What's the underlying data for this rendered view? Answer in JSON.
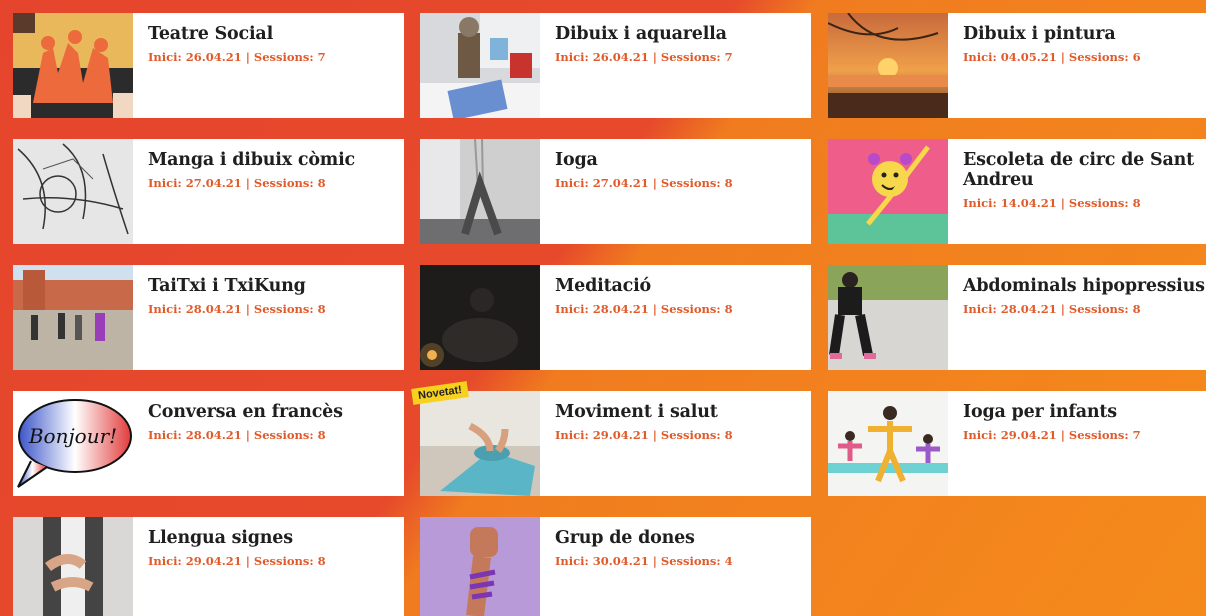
{
  "cards": [
    {
      "title": "Teatre Social",
      "meta": "Inici: 26.04.21 | Sessions: 7",
      "image": "theatre-illustration"
    },
    {
      "title": "Dibuix i aquarella",
      "meta": "Inici: 26.04.21 | Sessions: 7",
      "image": "painting-photo"
    },
    {
      "title": "Dibuix i pintura",
      "meta": "Inici: 04.05.21 | Sessions: 6",
      "image": "sunset-painting"
    },
    {
      "title": "Manga i dibuix còmic",
      "meta": "Inici: 27.04.21 | Sessions: 8",
      "image": "manga-sketch"
    },
    {
      "title": "Ioga",
      "meta": "Inici: 27.04.21 | Sessions: 8",
      "image": "aerial-yoga-photo"
    },
    {
      "title": "Escoleta de circ de Sant Andreu",
      "meta": "Inici: 14.04.21 | Sessions: 8",
      "image": "circus-drawing"
    },
    {
      "title": "TaiTxi i TxiKung",
      "meta": "Inici: 28.04.21 | Sessions: 8",
      "image": "taichi-photo"
    },
    {
      "title": "Meditació",
      "meta": "Inici: 28.04.21 | Sessions: 8",
      "image": "meditation-photo"
    },
    {
      "title": "Abdominals hipopressius",
      "meta": "Inici: 28.04.21 | Sessions: 8",
      "image": "squat-photo"
    },
    {
      "title": "Conversa en francès",
      "meta": "Inici: 28.04.21 | Sessions: 8",
      "image": "bonjour-bubble",
      "bubble_text": "Bonjour!"
    },
    {
      "title": "Moviment i salut",
      "meta": "Inici: 29.04.21 | Sessions: 8",
      "image": "yoga-mat-photo",
      "badge": "Novetat!"
    },
    {
      "title": "Ioga per infants",
      "meta": "Inici: 29.04.21 | Sessions: 7",
      "image": "kids-yoga-illustration"
    },
    {
      "title": "Llengua signes",
      "meta": "Inici: 29.04.21 | Sessions: 8",
      "image": "sign-language-photo"
    },
    {
      "title": "Grup de dones",
      "meta": "Inici: 30.04.21 | Sessions: 4",
      "image": "raised-fist-photo"
    }
  ],
  "colors": {
    "accent": "#e05a2a",
    "bg_red": "#e5452c",
    "bg_orange": "#f58a1c"
  }
}
